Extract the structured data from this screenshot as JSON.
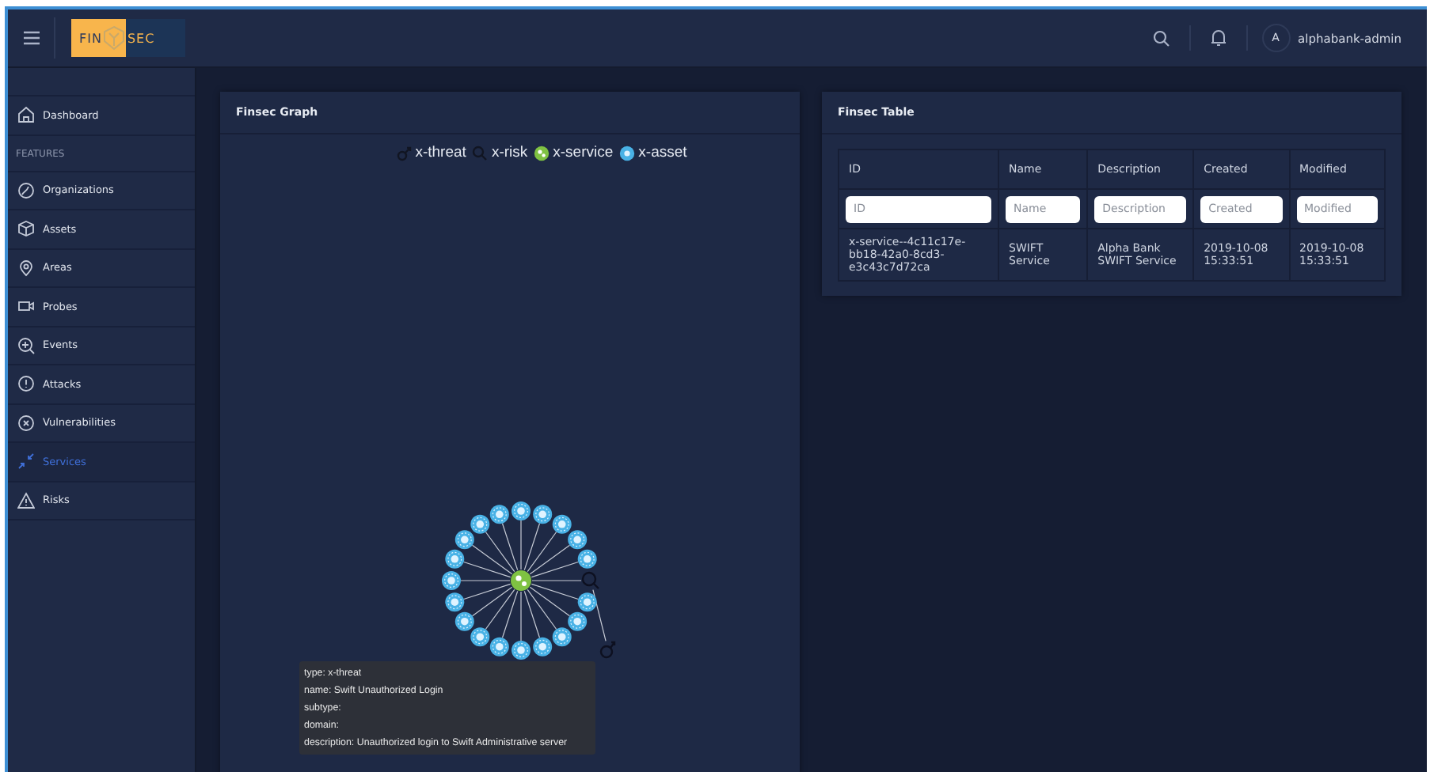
{
  "header": {
    "logo": {
      "left": "FIN",
      "right": "SEC"
    },
    "avatar": "A",
    "user": "alphabank-admin"
  },
  "sidebar": {
    "items": [
      {
        "label": "Dashboard",
        "kind": "item",
        "selected": false
      },
      {
        "label": "FEATURES",
        "kind": "section"
      },
      {
        "label": "Organizations",
        "kind": "item",
        "selected": false
      },
      {
        "label": "Assets",
        "kind": "item",
        "selected": false
      },
      {
        "label": "Areas",
        "kind": "item",
        "selected": false
      },
      {
        "label": "Probes",
        "kind": "item",
        "selected": false
      },
      {
        "label": "Events",
        "kind": "item",
        "selected": false
      },
      {
        "label": "Attacks",
        "kind": "item",
        "selected": false
      },
      {
        "label": "Vulnerabilities",
        "kind": "item",
        "selected": false
      },
      {
        "label": "Services",
        "kind": "item",
        "selected": true
      },
      {
        "label": "Risks",
        "kind": "item",
        "selected": false
      }
    ]
  },
  "graph": {
    "title": "Finsec Graph",
    "legend": [
      {
        "kind": "x-threat",
        "label": "x-threat"
      },
      {
        "kind": "x-risk",
        "label": "x-risk"
      },
      {
        "kind": "x-service",
        "label": "x-service"
      },
      {
        "kind": "x-asset",
        "label": "x-asset"
      }
    ],
    "center": {
      "kind": "x-service"
    },
    "nodes": [
      {
        "kind": "x-risk"
      },
      {
        "kind": "x-asset"
      },
      {
        "kind": "x-asset"
      },
      {
        "kind": "x-asset"
      },
      {
        "kind": "x-asset"
      },
      {
        "kind": "x-asset"
      },
      {
        "kind": "x-asset"
      },
      {
        "kind": "x-asset"
      },
      {
        "kind": "x-asset"
      },
      {
        "kind": "x-asset"
      },
      {
        "kind": "x-asset"
      },
      {
        "kind": "x-asset"
      },
      {
        "kind": "x-asset"
      },
      {
        "kind": "x-asset"
      },
      {
        "kind": "x-asset"
      },
      {
        "kind": "x-asset"
      },
      {
        "kind": "x-asset"
      },
      {
        "kind": "x-asset"
      },
      {
        "kind": "x-asset"
      },
      {
        "kind": "x-asset"
      }
    ],
    "outer": {
      "kind": "x-threat"
    },
    "tooltip": [
      "type: x-threat",
      "name: Swift Unauthorized Login",
      "subtype:",
      "domain:",
      "description: Unauthorized login to Swift Administrative server"
    ]
  },
  "table": {
    "title": "Finsec Table",
    "columns": [
      "ID",
      "Name",
      "Description",
      "Created",
      "Modified"
    ],
    "filters": [
      {
        "placeholder": "ID"
      },
      {
        "placeholder": "Name"
      },
      {
        "placeholder": "Description"
      },
      {
        "placeholder": "Created"
      },
      {
        "placeholder": "Modified"
      }
    ],
    "rows": [
      [
        "x-service--4c11c17e-bb18-42a0-8cd3-e3c43c7d72ca",
        "SWIFT Service",
        "Alpha Bank SWIFT Service",
        "2019-10-08 15:33:51",
        "2019-10-08 15:33:51"
      ]
    ]
  }
}
